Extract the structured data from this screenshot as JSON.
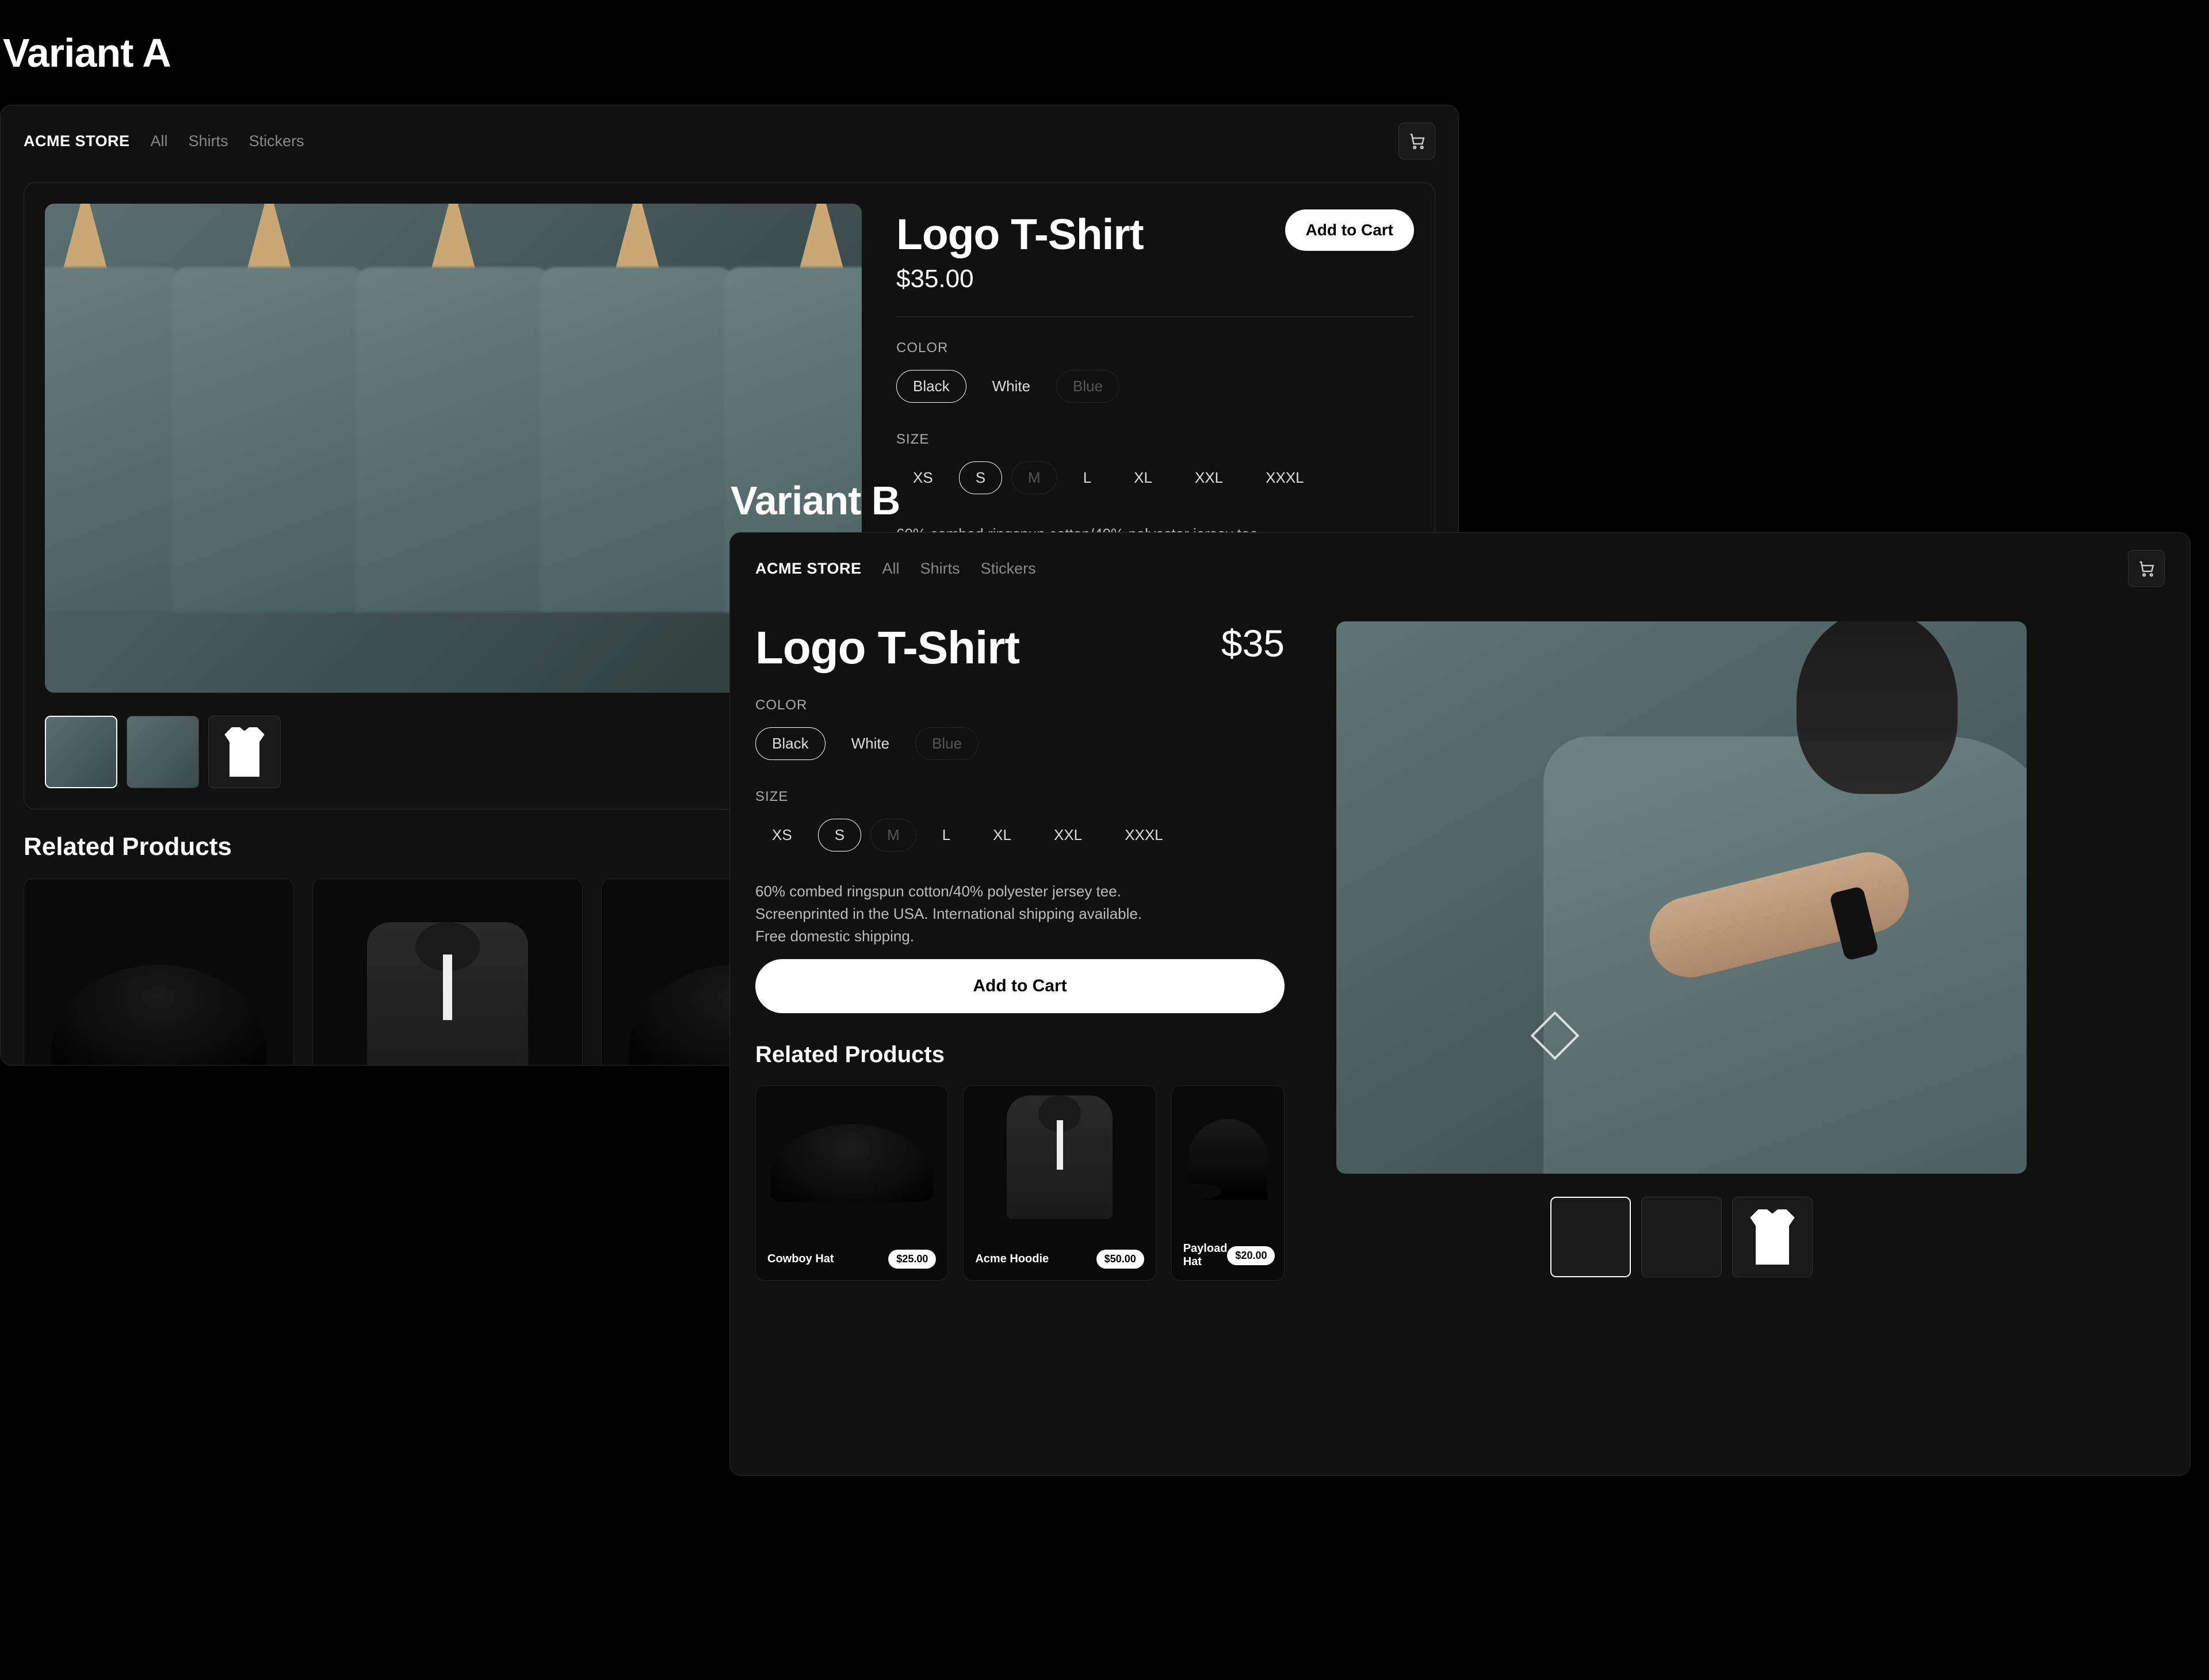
{
  "labels": {
    "variant_a": "Variant A",
    "variant_b": "Variant B"
  },
  "store": {
    "name": "ACME STORE",
    "nav": [
      "All",
      "Shirts",
      "Stickers"
    ]
  },
  "product": {
    "title": "Logo T-Shirt",
    "price_a": "$35.00",
    "price_b": "$35",
    "add_to_cart": "Add to Cart",
    "color_label": "COLOR",
    "colors": [
      {
        "name": "Black",
        "selected": true,
        "disabled": false
      },
      {
        "name": "White",
        "selected": false,
        "disabled": false
      },
      {
        "name": "Blue",
        "selected": false,
        "disabled": true
      }
    ],
    "size_label": "SIZE",
    "sizes": [
      {
        "name": "XS",
        "selected": false,
        "disabled": false
      },
      {
        "name": "S",
        "selected": true,
        "disabled": false
      },
      {
        "name": "M",
        "selected": false,
        "disabled": true
      },
      {
        "name": "L",
        "selected": false,
        "disabled": false
      },
      {
        "name": "XL",
        "selected": false,
        "disabled": false
      },
      {
        "name": "XXL",
        "selected": false,
        "disabled": false
      },
      {
        "name": "XXXL",
        "selected": false,
        "disabled": false
      }
    ],
    "description_a": "60% combed ringspun cotton/40% polyester jersey tee. Screenprinted",
    "description_b": "60% combed ringspun cotton/40% polyester jersey tee. Screenprinted in the USA. International shipping available. Free domestic shipping."
  },
  "related": {
    "title": "Related Products",
    "items": [
      {
        "name": "Cowboy Hat",
        "price": "$25.00"
      },
      {
        "name": "Acme Hoodie",
        "price": "$50.00"
      },
      {
        "name": "Payload Hat",
        "price": "$20.00"
      }
    ]
  }
}
